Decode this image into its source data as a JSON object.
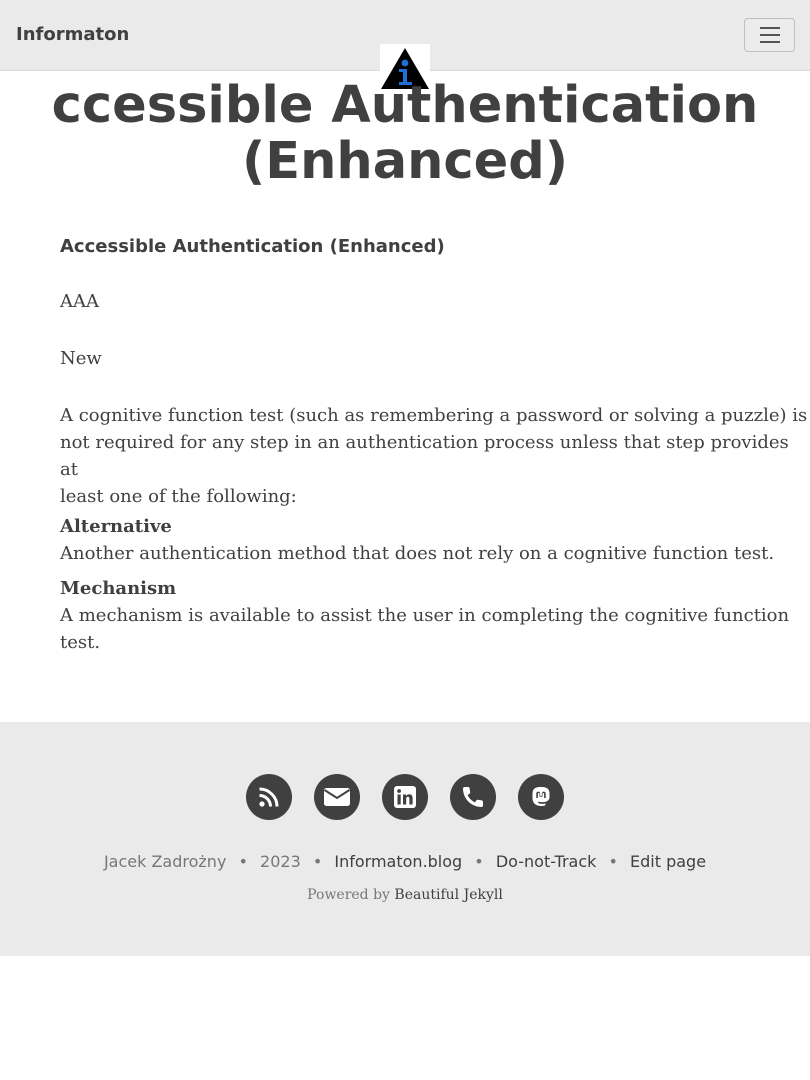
{
  "navbar": {
    "brand": "Informaton",
    "menu_icon": "hamburger-menu-icon",
    "logo_icon": "informaton-logo-icon"
  },
  "page": {
    "title_line1": "ccessible Authentication",
    "title_line2": "(Enhanced)"
  },
  "content": {
    "subheading": "Accessible Authentication (Enhanced)",
    "level": "AAA",
    "status": "New",
    "description_lines": [
      "A cognitive function test (such as remembering a password or solving a puzzle) is",
      "not required for any step in an authentication process unless that step provides at",
      "least one of the following:"
    ],
    "items": [
      {
        "term": "Alternative",
        "definition_lines": [
          "Another authentication method that does not rely on a cognitive function test."
        ]
      },
      {
        "term": "Mechanism",
        "definition_lines": [
          "A mechanism is available to assist the user in completing the cognitive function",
          "test."
        ]
      }
    ]
  },
  "footer": {
    "social_icons": [
      "rss-icon",
      "envelope-icon",
      "linkedin-icon",
      "phone-icon",
      "mastodon-icon"
    ],
    "author": "Jacek Zadrożny",
    "year": "2023",
    "site_link": "Informaton.blog",
    "dnt_link": "Do-not-Track",
    "edit_link": "Edit page",
    "separator": "•",
    "powered_prefix": "Powered by",
    "powered_link": "Beautiful Jekyll"
  },
  "colors": {
    "text": "#404040",
    "navbar_bg": "#eaeaea",
    "footer_bg": "#eaeaea",
    "logo_blue": "#1e6fd9"
  }
}
